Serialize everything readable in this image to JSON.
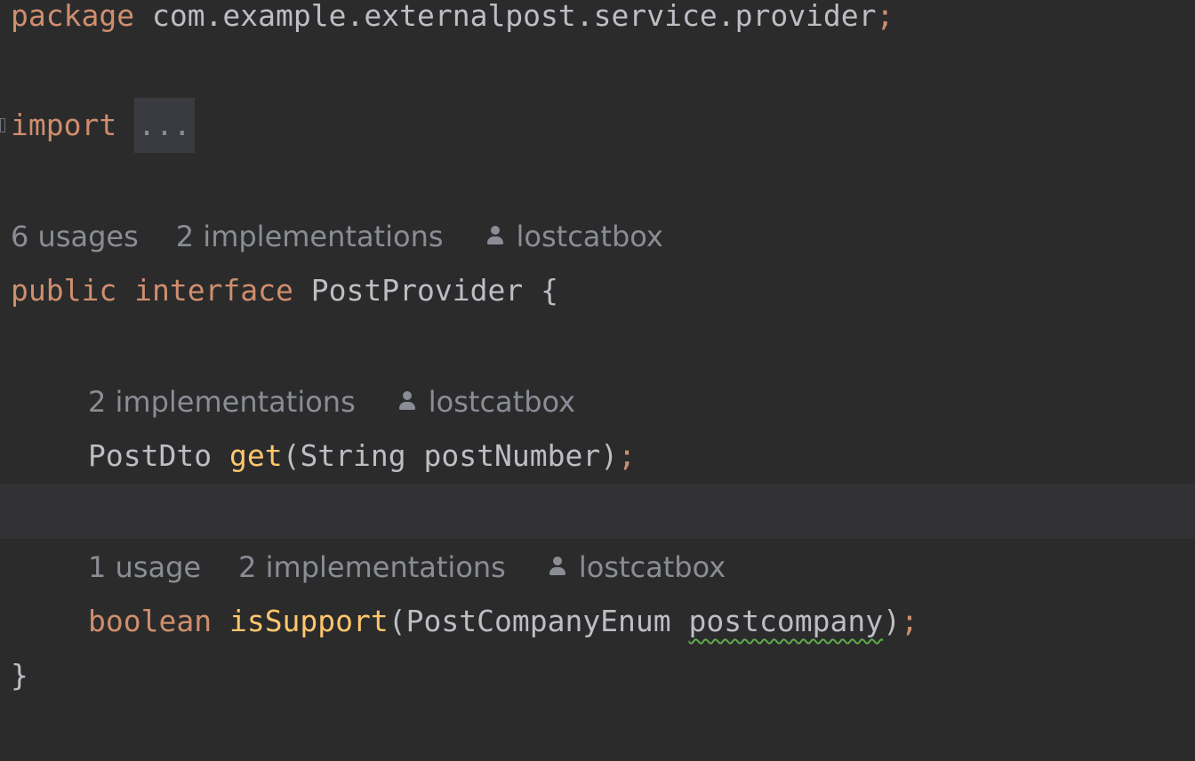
{
  "editor": {
    "line1": {
      "keyword": "package",
      "name": "com.example.externalpost.service.provider",
      "semicolon": ";"
    },
    "line2": {
      "keyword": "import",
      "folded": "..."
    },
    "hint_interface": {
      "usages": "6 usages",
      "implementations": "2 implementations",
      "author": "lostcatbox",
      "author_icon": "user-icon"
    },
    "line3": {
      "kw_public": "public",
      "kw_interface": "interface",
      "name": "PostProvider",
      "brace": "{"
    },
    "hint_get": {
      "implementations": "2 implementations",
      "author": "lostcatbox",
      "author_icon": "user-icon"
    },
    "line4": {
      "return_type": "PostDto",
      "method": "get",
      "open_paren": "(",
      "param_type": "String",
      "param_name": "postNumber",
      "close_paren": ")",
      "semicolon": ";"
    },
    "hint_support": {
      "usages": "1 usage",
      "implementations": "2 implementations",
      "author": "lostcatbox",
      "author_icon": "user-icon"
    },
    "line5": {
      "return_type": "boolean",
      "method": "isSupport",
      "open_paren": "(",
      "param_type": "PostCompanyEnum",
      "param_name": "postcompany",
      "close_paren": ")",
      "semicolon": ";"
    },
    "line6": {
      "brace": "}"
    },
    "colors": {
      "background": "#2b2b2c",
      "caret_line": "#323234",
      "keyword": "#cf8e6d",
      "identifier": "#bcbec4",
      "method": "#ffc66d",
      "hint": "#8a8d94",
      "warning_underline": "#5faa4b"
    }
  }
}
